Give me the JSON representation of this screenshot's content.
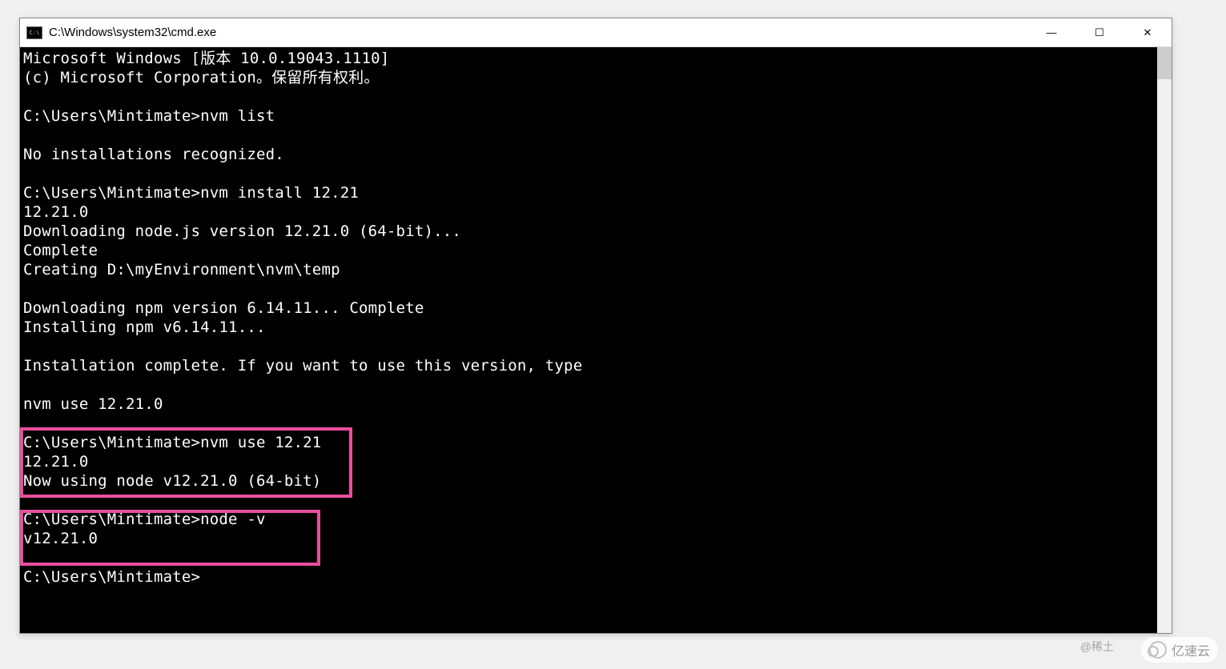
{
  "window": {
    "title": "C:\\Windows\\system32\\cmd.exe"
  },
  "controls": {
    "minimize": "—",
    "maximize": "☐",
    "close": "✕"
  },
  "terminal": {
    "lines": [
      "Microsoft Windows [版本 10.0.19043.1110]",
      "(c) Microsoft Corporation。保留所有权利。",
      "",
      "C:\\Users\\Mintimate>nvm list",
      "",
      "No installations recognized.",
      "",
      "C:\\Users\\Mintimate>nvm install 12.21",
      "12.21.0",
      "Downloading node.js version 12.21.0 (64-bit)...",
      "Complete",
      "Creating D:\\myEnvironment\\nvm\\temp",
      "",
      "Downloading npm version 6.14.11... Complete",
      "Installing npm v6.14.11...",
      "",
      "Installation complete. If you want to use this version, type",
      "",
      "nvm use 12.21.0",
      "",
      "C:\\Users\\Mintimate>nvm use 12.21",
      "12.21.0",
      "Now using node v12.21.0 (64-bit)",
      "",
      "C:\\Users\\Mintimate>node -v",
      "v12.21.0",
      "",
      "C:\\Users\\Mintimate>",
      ""
    ]
  },
  "watermark": {
    "left": "@稀土",
    "right": "亿速云"
  }
}
